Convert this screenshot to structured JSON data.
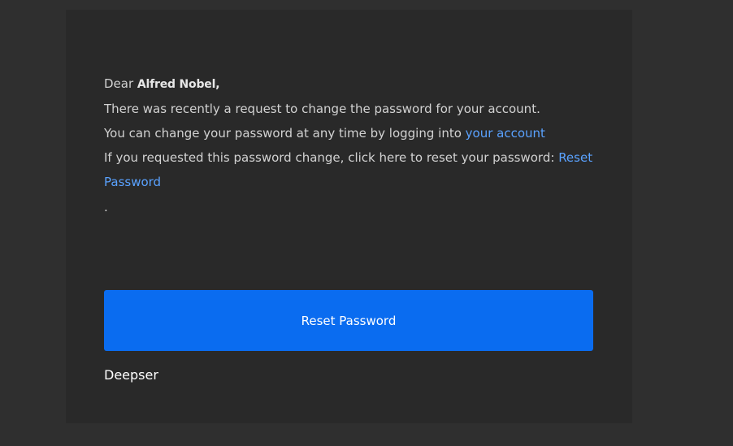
{
  "email": {
    "greeting_prefix": "Dear",
    "recipient_name": "Alfred Nobel,",
    "line1": "There was recently a request to change the password for your account.",
    "line2_text": "You can change your password at any time by logging into",
    "line2_link": "your account",
    "line3_text": "If you requested this password change, click here to reset your password:",
    "line3_link": "Reset Password",
    "trailing_dot": "."
  },
  "button": {
    "label": "Reset Password",
    "color": "#0a6cf0"
  },
  "signature": "Deepser",
  "colors": {
    "page_background": "#2f2f2f",
    "card_background": "#292929",
    "link": "#5aa2ff"
  }
}
